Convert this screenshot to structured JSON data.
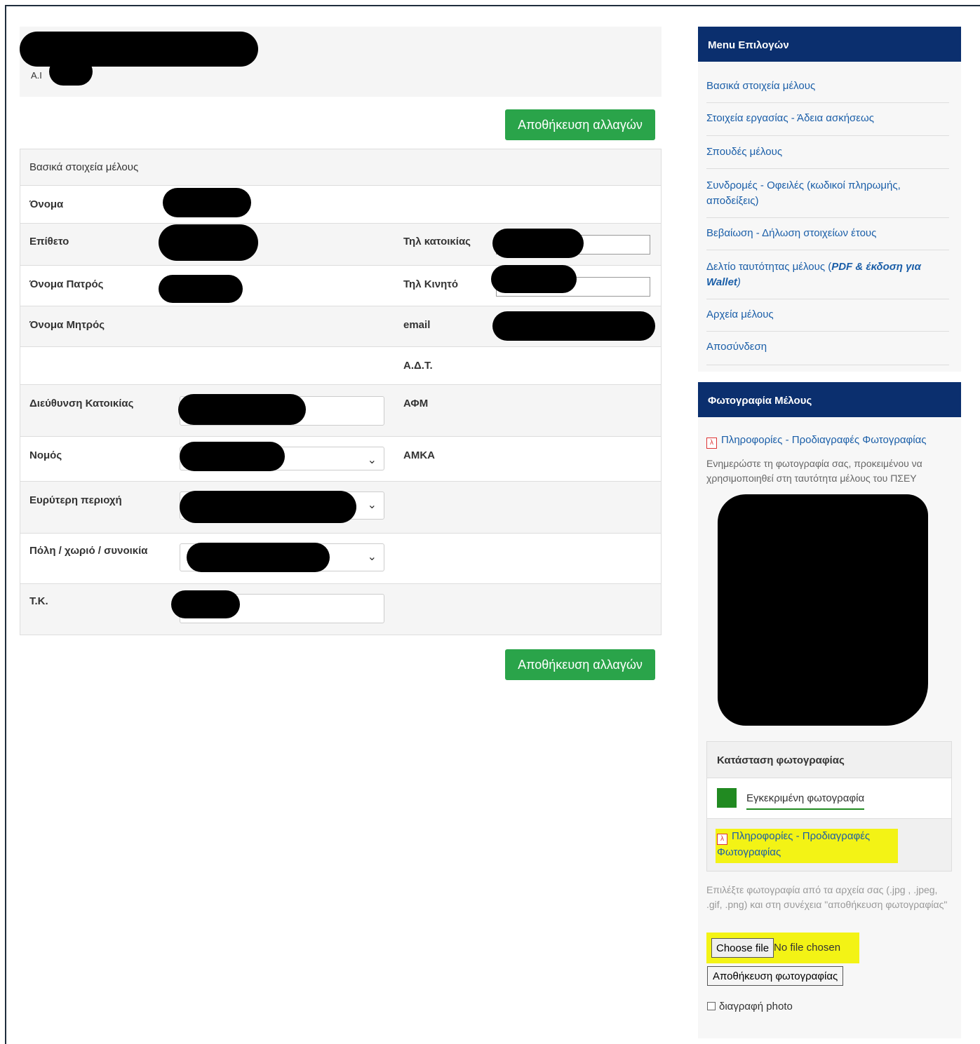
{
  "header": {
    "ident_prefix": "A.I"
  },
  "actions": {
    "save_label": "Αποθήκευση αλλαγών"
  },
  "form": {
    "section_title": "Βασικά στοιχεία μέλους",
    "first_name_label": "Όνομα",
    "last_name_label": "Επίθετο",
    "home_phone_label": "Τηλ κατοικίας",
    "father_name_label": "Όνομα Πατρός",
    "mobile_label": "Τηλ Κινητό",
    "mother_name_label": "Όνομα Μητρός",
    "email_label": "email",
    "id_card_label": "Α.Δ.Τ.",
    "address_label": "Διεύθυνση Κατοικίας",
    "tax_id_label": "ΑΦΜ",
    "prefecture_label": "Νομός",
    "ssn_label": "ΑΜΚΑ",
    "region_label": "Ευρύτερη περιοχή",
    "city_label": "Πόλη / χωριό / συνοικία",
    "postal_label": "Τ.Κ."
  },
  "menu": {
    "title": "Menu Επιλογών",
    "items": [
      "Βασικά στοιχεία μέλους",
      "Στοιχεία εργασίας - Άδεια ασκήσεως",
      "Σπουδές μέλους",
      "Συνδρομές - Οφειλές (κωδικοί πληρωμής, αποδείξεις)",
      "Βεβαίωση - Δήλωση στοιχείων έτους"
    ],
    "card_item_prefix": "Δελτίο ταυτότητας μέλους (",
    "card_item_emph": "PDF & έκδοση για Wallet",
    "card_item_suffix": ")",
    "files_item": "Αρχεία μέλους",
    "logout_item": "Αποσύνδεση"
  },
  "photo": {
    "title": "Φωτογραφία Μέλους",
    "spec_link": "Πληροφορίες - Προδιαγραφές Φωτογραφίας",
    "note": "Ενημερώστε τη φωτογραφία σας, προκειμένου να χρησιμοποιηθεί στη ταυτότητα μέλους του ΠΣΕΥ",
    "status_title": "Κατάσταση φωτογραφίας",
    "status_value": "Εγκεκριμένη φωτογραφία",
    "status_color": "#218a21",
    "spec_link_2": "Πληροφορίες - Προδιαγραφές Φωτογραφίας",
    "help": "Επιλέξτε φωτογραφία από τα αρχεία σας (.jpg , .jpeg, .gif, .png) και στη συνέχεια \"αποθήκευση φωτογραφίας\"",
    "choose_file": "Choose file",
    "no_file": "No file chosen",
    "save_photo": "Αποθήκευση φωτογραφίας",
    "delete_label": "διαγραφή photo"
  },
  "icons": {
    "pdf": "pdf-icon",
    "dropdown": "chevron-down-icon"
  },
  "colors": {
    "save_button": "#2aa44a",
    "sidebar_header": "#0b2f6e",
    "highlight": "#f3f315",
    "link": "#1a5ea8"
  }
}
